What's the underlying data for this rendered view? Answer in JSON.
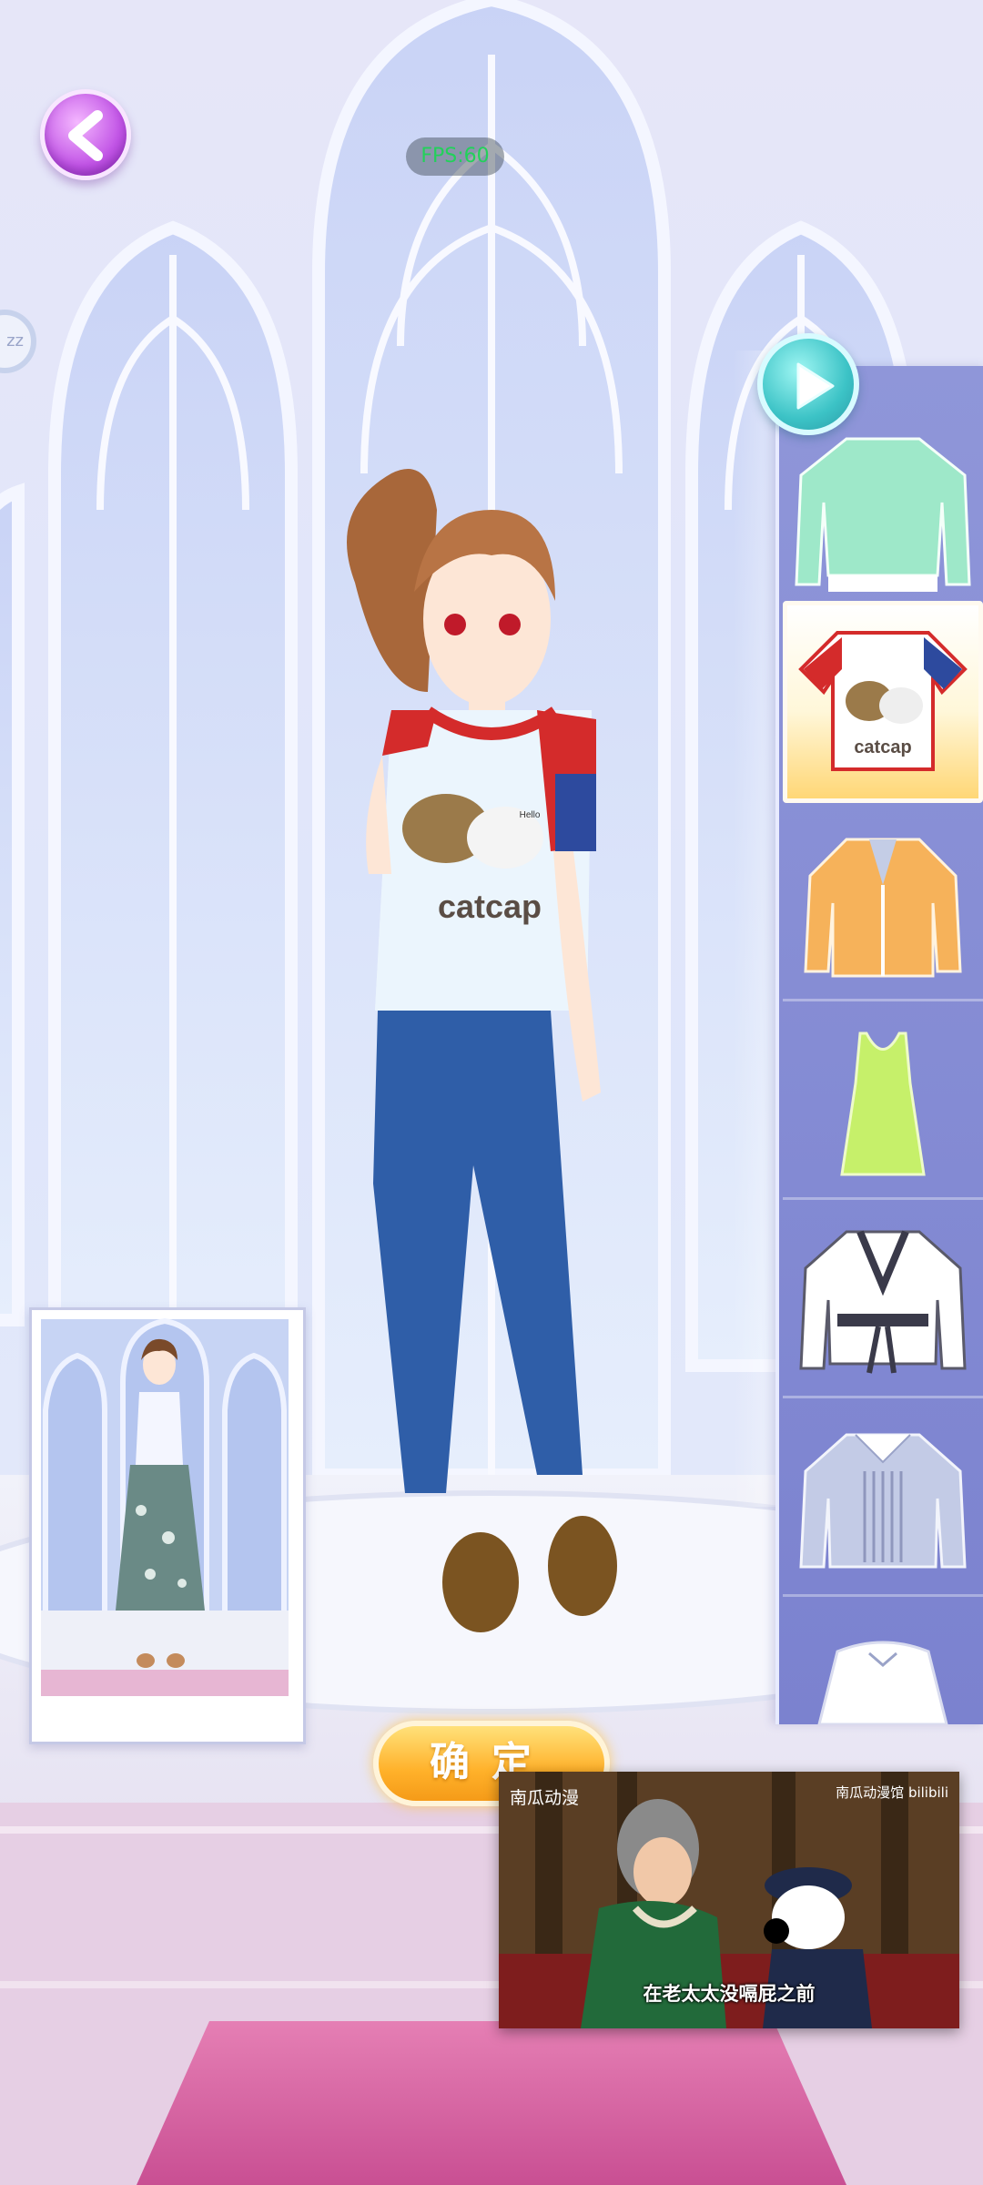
{
  "hud": {
    "fps_label": "FPS:60",
    "left_badge": "zz",
    "back_icon": "chevron-left-icon",
    "play_icon": "play-icon"
  },
  "character": {
    "shirt_text": "catcap",
    "shirt_small_text": "Hello"
  },
  "wardrobe": {
    "items": [
      {
        "name": "mint-long-sleeve-top",
        "selected": false
      },
      {
        "name": "catcap-bunny-tee",
        "selected": true,
        "text": "catcap"
      },
      {
        "name": "orange-cardigan",
        "selected": false
      },
      {
        "name": "green-tank-top",
        "selected": false
      },
      {
        "name": "white-wrap-jacket",
        "selected": false
      },
      {
        "name": "striped-collar-shirt",
        "selected": false
      },
      {
        "name": "white-blouse-partial",
        "selected": false
      }
    ]
  },
  "confirm_button": {
    "label": "确定"
  },
  "video": {
    "watermark_left": "南瓜动漫",
    "watermark_right": "南瓜动漫馆 bilibili",
    "subtitle": "在老太太没嗝屁之前"
  },
  "colors": {
    "back_button": "#c255e6",
    "play_button": "#3cc3c6",
    "confirm_button": "#ffb12a",
    "side_panel": "#8f96d9",
    "selected_item": "#ffd776"
  }
}
